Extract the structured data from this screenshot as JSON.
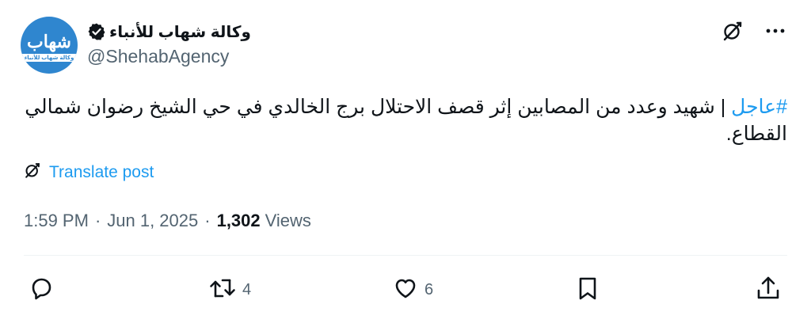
{
  "account": {
    "display_name": "وكالة شهاب للأنباء",
    "handle": "@ShehabAgency",
    "verified": true,
    "avatar": {
      "logo_text": "شهاب",
      "sub_text": "وكالة شهاب للأنباء",
      "color": "#2f86cf"
    }
  },
  "tweet": {
    "hashtag": "#عاجل",
    "text": " | شهيد وعدد من المصابين إثر قصف الاحتلال برج الخالدي في حي الشيخ رضوان شمالي القطاع."
  },
  "translate": {
    "label": "Translate post",
    "icon": "grok-icon"
  },
  "meta": {
    "time": "1:59 PM",
    "separator": "·",
    "date": "Jun 1, 2025",
    "views_count": "1,302",
    "views_label": "Views"
  },
  "actions": {
    "reply": {
      "icon": "reply-icon",
      "count": ""
    },
    "repost": {
      "icon": "repost-icon",
      "count": "4"
    },
    "like": {
      "icon": "heart-icon",
      "count": "6"
    },
    "bookmark": {
      "icon": "bookmark-icon",
      "count": ""
    },
    "share": {
      "icon": "share-icon",
      "count": ""
    }
  },
  "colors": {
    "accent": "#1d9bf0",
    "text": "#0f1419",
    "secondary": "#536471"
  }
}
